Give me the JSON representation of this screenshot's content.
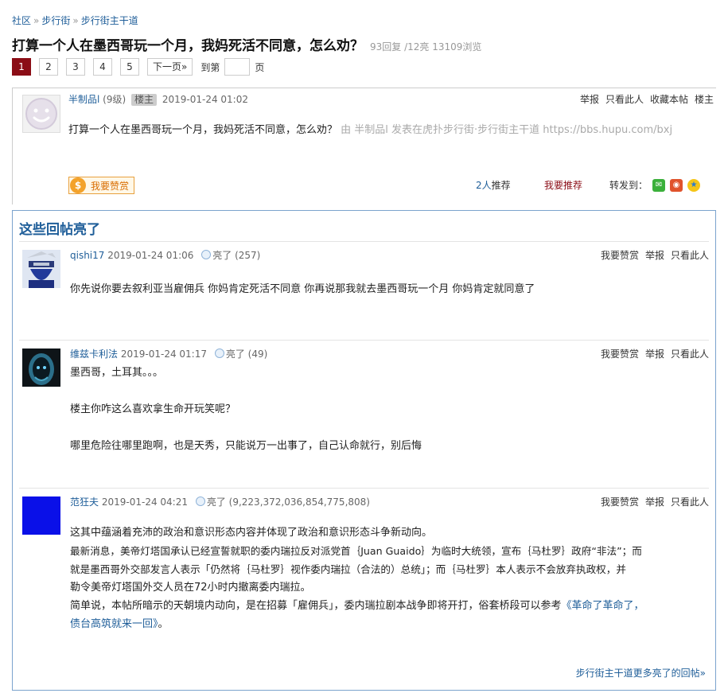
{
  "breadcrumb": {
    "items": [
      "社区",
      "步行街",
      "步行街主干道"
    ],
    "sep": "»"
  },
  "thread": {
    "title": "打算一个人在墨西哥玩一个月，我妈死活不同意，怎么劝？",
    "stats": "93回复 /12亮  13109浏览"
  },
  "pager": {
    "pages": [
      "1",
      "2",
      "3",
      "4",
      "5"
    ],
    "next": "下一页»",
    "goto_label": "到第",
    "page_label": "页"
  },
  "op": {
    "username": "半制品l",
    "level": "(9级)",
    "badge": "楼主",
    "time": "2019-01-24 01:02",
    "actions": [
      "举报",
      "只看此人",
      "收藏本帖",
      "楼主"
    ],
    "body": "打算一个人在墨西哥玩一个月，我妈死活不同意，怎么劝？",
    "source": "由  半制品l 发表在虎扑步行街·步行街主干道 https://bbs.hupu.com/bxj",
    "reward_label": "我要赞赏",
    "rec_count": "2人",
    "rec_suffix": "推荐",
    "rec_button": "我要推荐",
    "share_label": "转发到："
  },
  "highlights": {
    "title": "这些回帖亮了",
    "replies": [
      {
        "username": "qishi17",
        "time": "2019-01-24 01:06",
        "light_label": "亮了",
        "light_count": "(257)",
        "actions": [
          "我要赞赏",
          "举报",
          "只看此人"
        ],
        "lines": [
          "你先说你要去叙利亚当雇佣兵 你妈肯定死活不同意 你再说那我就去墨西哥玩一个月 你妈肯定就同意了"
        ]
      },
      {
        "username": "维兹卡利法",
        "time": "2019-01-24 01:17",
        "light_label": "亮了",
        "light_count": "(49)",
        "actions": [
          "我要赞赏",
          "举报",
          "只看此人"
        ],
        "lines": [
          "墨西哥，土耳其。。。",
          "楼主你咋这么喜欢拿生命开玩笑呢？",
          "哪里危险往哪里跑啊，也是天秀，只能说万一出事了，自己认命就行，别后悔"
        ]
      },
      {
        "username": "范狂夫",
        "time": "2019-01-24 04:21",
        "light_label": "亮了",
        "light_count": "(9,223,372,036,854,775,808)",
        "actions": [
          "我要赞赏",
          "举报",
          "只看此人"
        ],
        "lines": [
          "这其中蕴涵着充沛的政治和意识形态内容并体现了政治和意识形态斗争新动向。",
          "最新消息，美帝灯塔国承认已经宣誓就职的委内瑞拉反对派党首｛Juan Guaido｝为临时大统领，宣布｛马杜罗｝政府“非法”；而",
          "就是墨西哥外交部发言人表示「仍然将｛马杜罗｝视作委内瑞拉（合法的）总统」；而｛马杜罗｝本人表示不会放弃执政权，并",
          "勒令美帝灯塔国外交人员在72小时内撤离委内瑞拉。",
          "简单说，本帖所暗示的天朝境内动向，是在招募「雇佣兵」，委内瑞拉剧本战争即将开打，俗套桥段可以参考"
        ],
        "link1": "《革命了革命了，",
        "link2": "债台高筑就来一回》",
        "tail": "。"
      }
    ],
    "more_link": "步行街主干道更多亮了的回帖»"
  },
  "colors": {
    "accent": "#8b0d16",
    "link": "#1f5e99",
    "box_border": "#7ba3cd"
  }
}
